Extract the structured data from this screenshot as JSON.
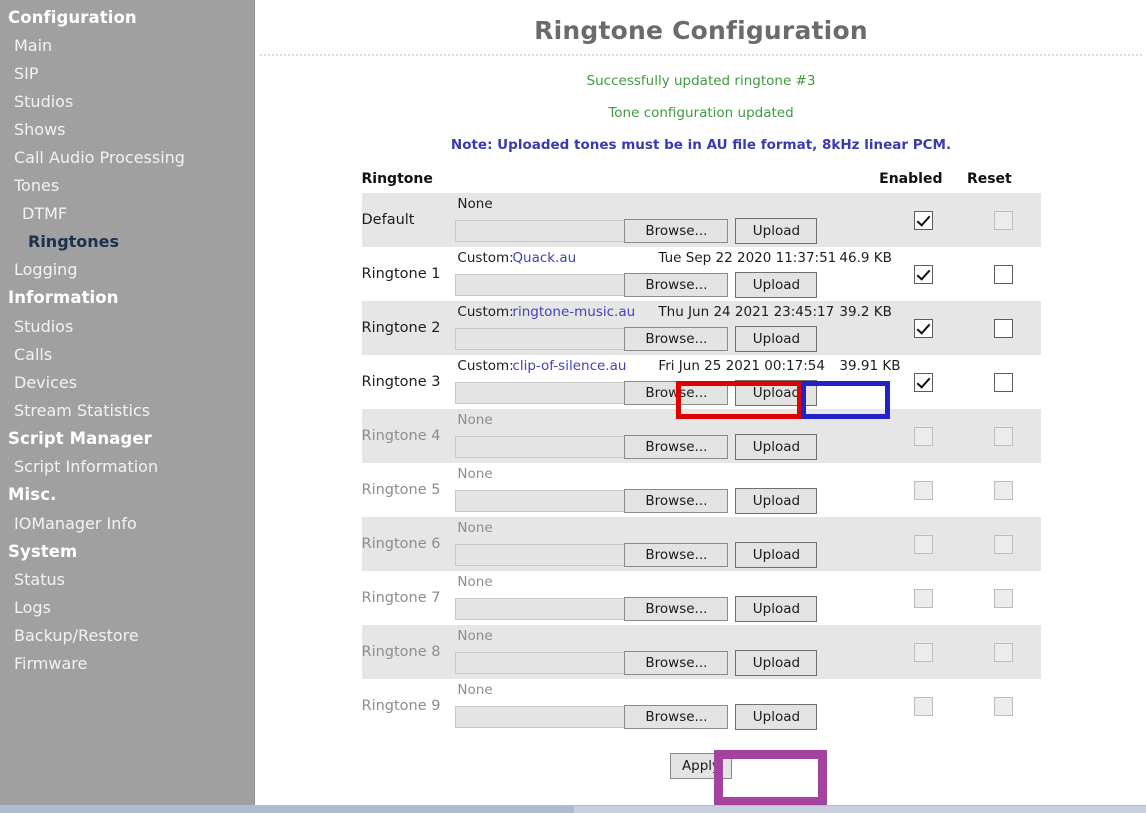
{
  "sidebar": {
    "items": [
      {
        "label": "Configuration",
        "type": "group"
      },
      {
        "label": "Main",
        "type": "item"
      },
      {
        "label": "SIP",
        "type": "item"
      },
      {
        "label": "Studios",
        "type": "item"
      },
      {
        "label": "Shows",
        "type": "item"
      },
      {
        "label": "Call Audio Processing",
        "type": "item"
      },
      {
        "label": "Tones",
        "type": "item"
      },
      {
        "label": "DTMF",
        "type": "sub"
      },
      {
        "label": "Ringtones",
        "type": "current"
      },
      {
        "label": "Logging",
        "type": "item"
      },
      {
        "label": "Information",
        "type": "group"
      },
      {
        "label": "Studios",
        "type": "item"
      },
      {
        "label": "Calls",
        "type": "item"
      },
      {
        "label": "Devices",
        "type": "item"
      },
      {
        "label": "Stream Statistics",
        "type": "item"
      },
      {
        "label": "Script Manager",
        "type": "group"
      },
      {
        "label": "Script Information",
        "type": "item"
      },
      {
        "label": "Misc.",
        "type": "group"
      },
      {
        "label": "IOManager Info",
        "type": "item"
      },
      {
        "label": "System",
        "type": "group"
      },
      {
        "label": "Status",
        "type": "item"
      },
      {
        "label": "Logs",
        "type": "item"
      },
      {
        "label": "Backup/Restore",
        "type": "item"
      },
      {
        "label": "Firmware",
        "type": "item"
      }
    ]
  },
  "page": {
    "title": "Ringtone Configuration",
    "message_1": "Successfully updated ringtone #3",
    "message_2": "Tone configuration updated",
    "note": "Note: Uploaded tones must be in AU file format, 8kHz linear PCM.",
    "success_color": "#3f9b3f",
    "note_color": "#3b3bb0"
  },
  "table": {
    "headers": {
      "ringtone": "Ringtone",
      "enabled": "Enabled",
      "reset": "Reset"
    },
    "browse_label": "Browse...",
    "upload_label": "Upload",
    "rows": [
      {
        "name": "Default",
        "file_label": "None",
        "file_name": "",
        "date": "",
        "size": "",
        "enabled": true,
        "reset": false,
        "disabled": false,
        "reset_disabled": true
      },
      {
        "name": "Ringtone 1",
        "file_label": "Custom:",
        "file_name": "Quack.au",
        "date": "Tue Sep 22 2020 11:37:51",
        "size": "46.9 KB",
        "enabled": true,
        "reset": false,
        "disabled": false,
        "reset_disabled": false
      },
      {
        "name": "Ringtone 2",
        "file_label": "Custom:",
        "file_name": "ringtone-music.au",
        "date": "Thu Jun 24 2021 23:45:17",
        "size": "39.2 KB",
        "enabled": true,
        "reset": false,
        "disabled": false,
        "reset_disabled": false
      },
      {
        "name": "Ringtone 3",
        "file_label": "Custom:",
        "file_name": "clip-of-silence.au",
        "date": "Fri Jun 25 2021 00:17:54",
        "size": "39.91 KB",
        "enabled": true,
        "reset": false,
        "disabled": false,
        "reset_disabled": false
      },
      {
        "name": "Ringtone 4",
        "file_label": "None",
        "file_name": "",
        "date": "",
        "size": "",
        "enabled": false,
        "reset": false,
        "disabled": true,
        "reset_disabled": true
      },
      {
        "name": "Ringtone 5",
        "file_label": "None",
        "file_name": "",
        "date": "",
        "size": "",
        "enabled": false,
        "reset": false,
        "disabled": true,
        "reset_disabled": true
      },
      {
        "name": "Ringtone 6",
        "file_label": "None",
        "file_name": "",
        "date": "",
        "size": "",
        "enabled": false,
        "reset": false,
        "disabled": true,
        "reset_disabled": true
      },
      {
        "name": "Ringtone 7",
        "file_label": "None",
        "file_name": "",
        "date": "",
        "size": "",
        "enabled": false,
        "reset": false,
        "disabled": true,
        "reset_disabled": true
      },
      {
        "name": "Ringtone 8",
        "file_label": "None",
        "file_name": "",
        "date": "",
        "size": "",
        "enabled": false,
        "reset": false,
        "disabled": true,
        "reset_disabled": true
      },
      {
        "name": "Ringtone 9",
        "file_label": "None",
        "file_name": "",
        "date": "",
        "size": "",
        "enabled": false,
        "reset": false,
        "disabled": true,
        "reset_disabled": true
      }
    ]
  },
  "apply": {
    "label": "Apply"
  },
  "highlights": [
    {
      "name": "browse-highlight",
      "color": "#e00000"
    },
    {
      "name": "upload-highlight",
      "color": "#2222c8"
    },
    {
      "name": "apply-highlight",
      "color": "#a3439e"
    }
  ]
}
